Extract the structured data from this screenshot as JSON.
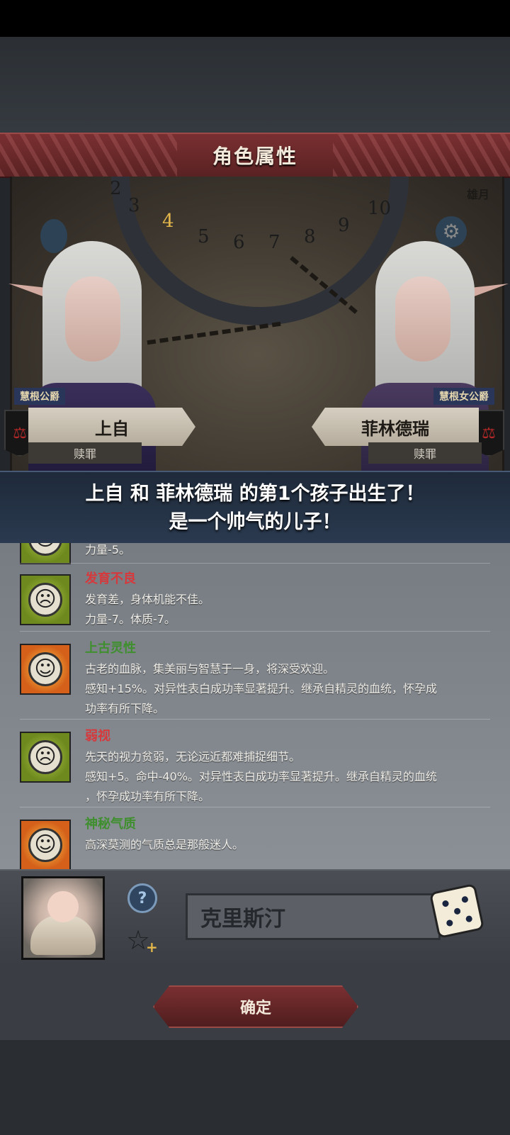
{
  "header": {
    "title": "角色属性"
  },
  "scene": {
    "dial_numbers": [
      "2",
      "3",
      "4",
      "5",
      "6",
      "7",
      "8",
      "9",
      "10"
    ],
    "current_month_number": "4",
    "corner_label": "雄月"
  },
  "father": {
    "rank": "慧根公爵",
    "name": "上自",
    "status": "赎罪"
  },
  "mother": {
    "rank": "慧根女公爵",
    "name": "菲林德瑞",
    "status": "赎罪"
  },
  "announcement": {
    "line1": "上自 和 菲林德瑞 的第1个孩子出生了！",
    "line2": "是一个帅气的儿子！"
  },
  "traits": [
    {
      "name": "",
      "icon": "sad-face-icon",
      "tone": "green",
      "lines": [
        "力量-5。"
      ]
    },
    {
      "name": "发育不良",
      "icon": "sad-face-icon",
      "tone": "green",
      "kind": "neg",
      "lines": [
        "发育差，身体机能不佳。",
        "力量-7。体质-7。"
      ]
    },
    {
      "name": "上古灵性",
      "icon": "happy-face-icon",
      "tone": "orange",
      "kind": "pos",
      "lines": [
        "古老的血脉，集美丽与智慧于一身，将深受欢迎。",
        "感知+15%。对异性表白成功率显著提升。继承自精灵的血统，怀孕成",
        "功率有所下降。"
      ]
    },
    {
      "name": "弱视",
      "icon": "sad-face-icon",
      "tone": "green",
      "kind": "neg",
      "lines": [
        "先天的视力贫弱，无论远近都难捕捉细节。",
        "感知+5。命中-40%。对异性表白成功率显著提升。继承自精灵的血统",
        "，怀孕成功率有所下降。"
      ]
    },
    {
      "name": "神秘气质",
      "icon": "happy-face-icon",
      "tone": "orange",
      "kind": "pos",
      "lines": [
        "高深莫测的气质总是那般迷人。"
      ]
    }
  ],
  "child": {
    "name_value": "克里斯汀"
  },
  "buttons": {
    "confirm": "确定"
  },
  "colors": {
    "header": "#7a2f31",
    "negative_trait": "#d7383b",
    "positive_trait": "#3f8f2e"
  }
}
